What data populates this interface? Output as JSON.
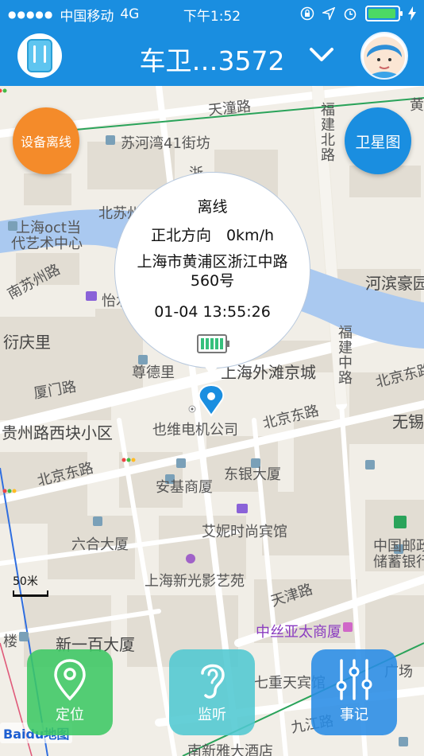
{
  "status_bar": {
    "carrier": "中国移动",
    "network": "4G",
    "time": "下午1:52"
  },
  "header": {
    "title": "车卫…3572"
  },
  "map": {
    "labels": {
      "tianchi_road": "天潼路",
      "suhewan": "苏河湾41街坊",
      "north_suzhou_road": "北苏州路",
      "fujian_north_road": "福建北路",
      "shanghai_oct_1": "上海oct当",
      "shanghai_oct_2": "代艺术中心",
      "south_suzhou_road": "南苏州路",
      "yishui_haoting": "怡水豪庭",
      "hebin_haoyuan": "河滨豪园",
      "yanqingli": "衍庆里",
      "fujian_middle_road": "福建中路",
      "zundeli": "尊德里",
      "waitan_jingcheng": "上海外滩京城",
      "xiamen_road": "厦门路",
      "north_jingdong_road_1": "北京东路",
      "wuxi": "无锡",
      "guizhou_road_block": "贵州路西块小区",
      "yewei_company": "也维电机公司",
      "north_jingdong_road_2": "北京东路",
      "north_jingdong_road_3": "北京东路",
      "dongyin_building": "东银大厦",
      "anji_shangsha": "安基商厦",
      "liuhe_building": "六合大厦",
      "ani_hotel": "艾妮时尚宾馆",
      "china_post_1": "中国邮政",
      "china_post_2": "储蓄银行",
      "xinguang_cinema": "上海新光影艺苑",
      "tianjin_road": "天津路",
      "zhongsi_building": "中丝亚太商厦",
      "building_lou": "楼",
      "xinyibai_building": "新一百大厦",
      "qizhongtian_hotel": "七重天宾馆",
      "jiujiang_road": "九江路",
      "nanxinya_hotel": "南新雅大酒店",
      "zhejiang_road": "浙江路",
      "huangpu_label": "黄",
      "guangchang": "广场"
    },
    "scale_label": "50米",
    "baidu_logo": "Baidu地图"
  },
  "buttons": {
    "device_offline": "设备离线",
    "satellite": "卫星图"
  },
  "popup": {
    "status": "离线",
    "direction_speed": "正北方向　0km/h",
    "address": "上海市黄浦区浙江中路560号",
    "datetime": "01-04 13:55:26",
    "battery_level": 1.0
  },
  "bottom_bar": {
    "locate": "定位",
    "listen": "监听",
    "record": "事记"
  },
  "colors": {
    "header_blue": "#1a8ee0",
    "offline_orange": "#f48b2a",
    "locate_green": "#3cc864",
    "listen_cyan": "#50c8d2",
    "record_blue": "#288ce6"
  }
}
